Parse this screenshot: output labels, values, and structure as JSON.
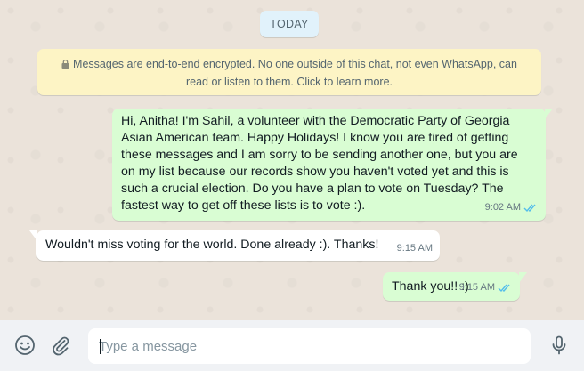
{
  "date_chip": "TODAY",
  "encryption_notice": "Messages are end-to-end encrypted. No one outside of this chat, not even WhatsApp, can read or listen to them. Click to learn more.",
  "messages": [
    {
      "direction": "outgoing",
      "text": "Hi, Anitha! I'm Sahil, a volunteer with the Democratic Party of Georgia Asian American team. Happy Holidays! I know you are tired of getting these messages and I am sorry to be sending another one, but you are on my list because our records show you haven't voted yet and this is such a crucial election. Do you have a plan to vote on Tuesday? The fastest way to get off these lists is to vote :).",
      "time": "9:02 AM",
      "status_icon": "double-check-read-icon"
    },
    {
      "direction": "incoming",
      "text": "Wouldn't miss voting for the world. Done already :). Thanks!",
      "time": "9:15 AM"
    },
    {
      "direction": "outgoing",
      "text": "Thank you!! :)",
      "time": "9:15 AM",
      "status_icon": "double-check-read-icon"
    }
  ],
  "composer": {
    "placeholder": "Type a message",
    "value": "",
    "emoji_icon": "emoji-icon",
    "attach_icon": "paperclip-icon",
    "mic_icon": "microphone-icon"
  },
  "colors": {
    "outgoing_bubble": "#d9fdd3",
    "incoming_bubble": "#ffffff",
    "encryption_bg": "#fdf4c5",
    "date_chip_bg": "#e1f2fb",
    "read_ticks": "#53bdeb",
    "wallpaper": "#ebe3da",
    "composer_bg": "#f0f2f5"
  }
}
